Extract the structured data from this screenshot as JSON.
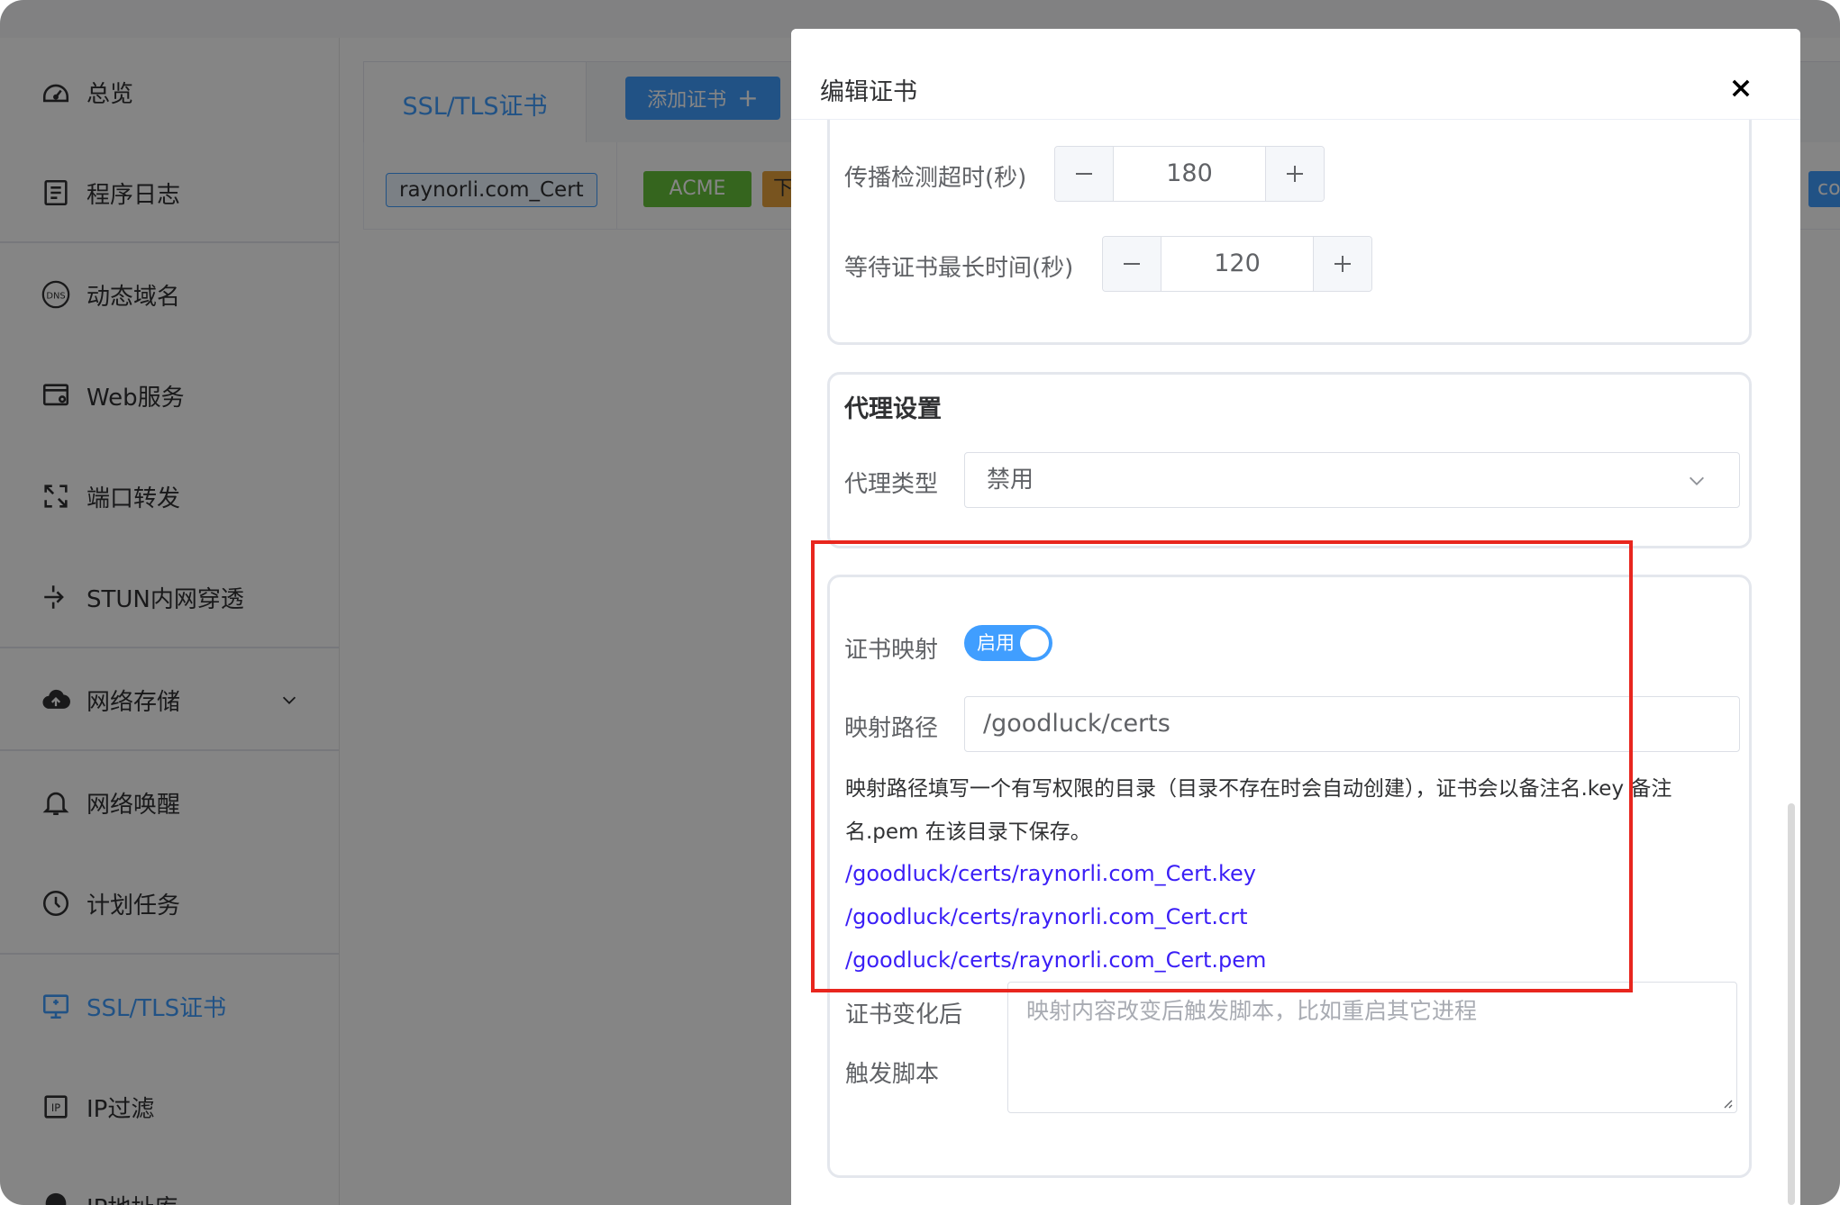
{
  "sidebar": {
    "items": [
      {
        "label": "总览",
        "icon": "dashboard-icon"
      },
      {
        "label": "程序日志",
        "icon": "log-icon"
      },
      {
        "label": "动态域名",
        "icon": "dns-icon"
      },
      {
        "label": "Web服务",
        "icon": "web-service-icon"
      },
      {
        "label": "端口转发",
        "icon": "port-forward-icon"
      },
      {
        "label": "STUN内网穿透",
        "icon": "stun-icon"
      },
      {
        "label": "网络存储",
        "icon": "cloud-storage-icon"
      },
      {
        "label": "网络唤醒",
        "icon": "bell-icon"
      },
      {
        "label": "计划任务",
        "icon": "clock-icon"
      },
      {
        "label": "SSL/TLS证书",
        "icon": "certificate-icon"
      },
      {
        "label": "IP过滤",
        "icon": "ip-filter-icon"
      },
      {
        "label": "IP地址库",
        "icon": "ip-database-icon"
      }
    ],
    "active_index": 9
  },
  "main": {
    "tab_label": "SSL/TLS证书",
    "add_button_label": "添加证书",
    "row": {
      "cert_name": "raynorli.com_Cert",
      "acme_tag": "ACME",
      "download_tag": "下",
      "domain_tag_fragment": "com."
    }
  },
  "dialog": {
    "title": "编辑证书",
    "propagation_timeout_label": "传播检测超时(秒)",
    "propagation_timeout_value": "180",
    "wait_cert_label": "等待证书最长时间(秒)",
    "wait_cert_value": "120",
    "proxy_section_title": "代理设置",
    "proxy_type_label": "代理类型",
    "proxy_type_value": "禁用",
    "cert_mapping_label": "证书映射",
    "cert_mapping_switch_text": "启用",
    "mapping_path_label": "映射路径",
    "mapping_path_value": "/goodluck/certs",
    "mapping_desc_line1": "映射路径填写一个有写权限的目录（目录不存在时会自动创建），证书会以备注名.key 备注",
    "mapping_desc_line2": "名.pem 在该目录下保存。",
    "mapped_files": [
      "/goodluck/certs/raynorli.com_Cert.key",
      "/goodluck/certs/raynorli.com_Cert.crt",
      "/goodluck/certs/raynorli.com_Cert.pem"
    ],
    "script_label_line1": "证书变化后",
    "script_label_line2": "触发脚本",
    "script_placeholder": "映射内容改变后触发脚本，比如重启其它进程"
  },
  "colors": {
    "accent": "#409eff",
    "highlight_box": "#e8261e",
    "path_link": "#3a1ef6",
    "acme_tag": "#67c23a"
  }
}
